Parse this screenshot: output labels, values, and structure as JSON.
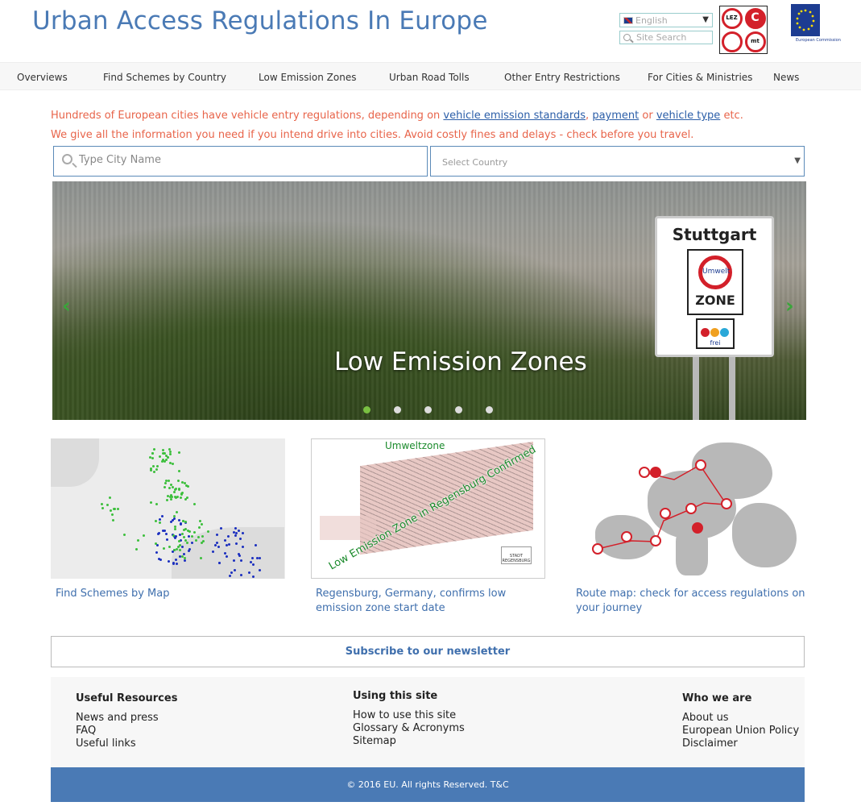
{
  "header": {
    "title": "Urban Access Regulations In Europe",
    "language": "English",
    "search_placeholder": "Site Search",
    "logo_cells": [
      "LEZ",
      "C",
      "",
      "mt"
    ],
    "eu_logo_text": "European Commission"
  },
  "nav": {
    "items": [
      "Overviews",
      "Find Schemes by Country",
      "Low Emission Zones",
      "Urban Road Tolls",
      "Other Entry Restrictions",
      "For Cities & Ministries",
      "News"
    ]
  },
  "intro": {
    "line1_prefix": "Hundreds of European cities have vehicle entry regulations, depending on",
    "link_emission": "vehicle emission standards",
    "comma": ",",
    "link_payment": "payment",
    "or": "or",
    "link_vehicle": "vehicle type",
    "etc": "etc.",
    "line2": "We give all the information you need if you intend drive into cities. Avoid costly fines and delays - check before you travel."
  },
  "search": {
    "city_placeholder": "Type City Name",
    "country_placeholder": "Select Country"
  },
  "hero": {
    "caption": "Low Emission Zones",
    "sign_city": "Stuttgart",
    "sign_ring": "Umwelt",
    "sign_zone": "ZONE",
    "sign_frei": "frei",
    "prev_arrow": "‹",
    "next_arrow": "›",
    "slide_count": 5,
    "active_slide": 1
  },
  "cards": [
    {
      "link": "Find Schemes by Map"
    },
    {
      "link": "Regensburg, Germany, confirms low emission zone start date",
      "img_title": "Umweltzone",
      "img_caption": "Low Emission Zone in Regensburg Confirmed",
      "img_stamp": "STADT REGENSBURG"
    },
    {
      "link": "Route map: check for access regulations on your journey"
    }
  ],
  "newsletter": {
    "label": "Subscribe to our newsletter"
  },
  "footer": {
    "col1": {
      "heading": "Useful Resources",
      "links": [
        "News and press",
        "FAQ",
        "Useful links"
      ]
    },
    "col2": {
      "heading": "Using this site",
      "links": [
        "How to use this site",
        "Glossary & Acronyms",
        "Sitemap"
      ]
    },
    "col3": {
      "heading": "Who we are",
      "links": [
        "About us",
        "European Union Policy",
        "Disclaimer"
      ]
    }
  },
  "copyright": "© 2016 EU. All rights Reserved. T&C",
  "colors": {
    "brand_blue": "#4a7ab5",
    "intro_orange": "#e8644a",
    "link_blue": "#2b5ea8",
    "active_dot": "#7ac142"
  }
}
